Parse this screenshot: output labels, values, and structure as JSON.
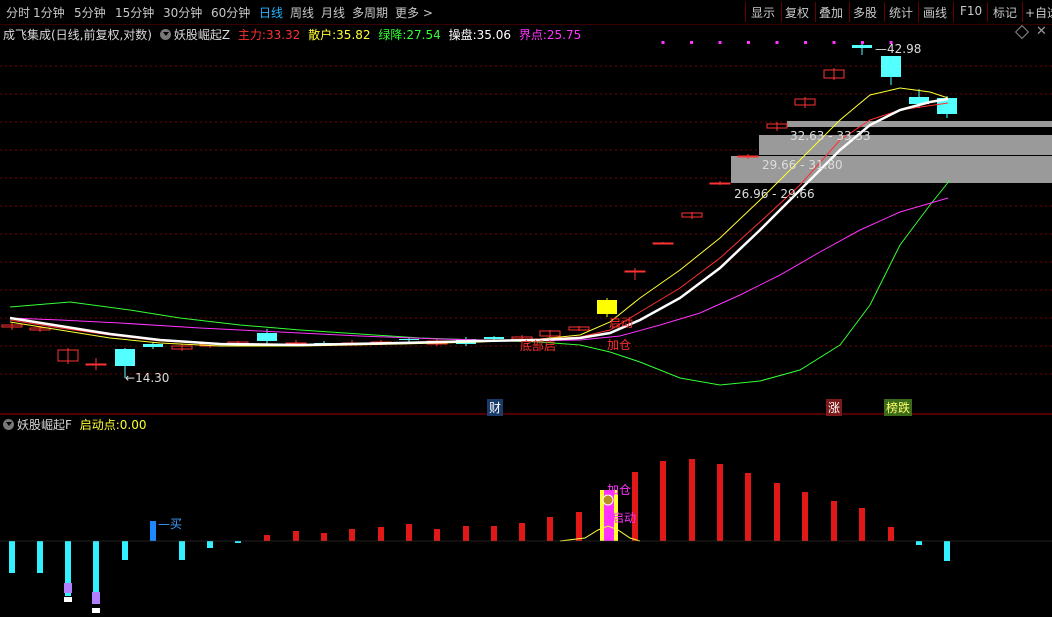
{
  "toolbar": {
    "periods": [
      "分时",
      "1分钟",
      "5分钟",
      "15分钟",
      "30分钟",
      "60分钟",
      "日线",
      "周线",
      "月线",
      "多周期",
      "更多"
    ],
    "active_period": "日线",
    "right_buttons": [
      "显示",
      "复权",
      "叠加",
      "多股",
      "统计",
      "画线",
      "F10",
      "标记",
      "+自选"
    ]
  },
  "main_legend": {
    "title": "成飞集成(日线,前复权,对数)",
    "indicator": "妖股崛起Z",
    "items": [
      {
        "label": "主力:",
        "value": "33.32",
        "color": "#ff3030"
      },
      {
        "label": "散户:",
        "value": "35.82",
        "color": "#ffff33"
      },
      {
        "label": "绿降:",
        "value": "27.54",
        "color": "#33ff33"
      },
      {
        "label": "操盘:",
        "value": "35.06",
        "color": "#ffffff"
      },
      {
        "label": "界点:",
        "value": "25.75",
        "color": "#ff33ff"
      }
    ]
  },
  "price_annotations": {
    "high": "42.98",
    "low": "14.30",
    "zone1": "32.63 - 33.33",
    "zone2": "29.66 - 31.80",
    "zone3": "26.96 - 29.66",
    "label_qidong": "启动",
    "label_jiacang": "加仓",
    "label_dijing": "底部启"
  },
  "event_markers": {
    "cai": "财",
    "zhang": "涨",
    "bang": "榜跌"
  },
  "sub_legend": {
    "indicator": "妖股崛起F",
    "label": "启动点:",
    "value": "0.00"
  },
  "sub_annotations": {
    "buy": "买",
    "jiacang": "加仓",
    "qidong": "启动"
  },
  "colors": {
    "up": "#ff3232",
    "down": "#54ffff",
    "grid": "#7a0000",
    "separator": "#900000"
  }
}
